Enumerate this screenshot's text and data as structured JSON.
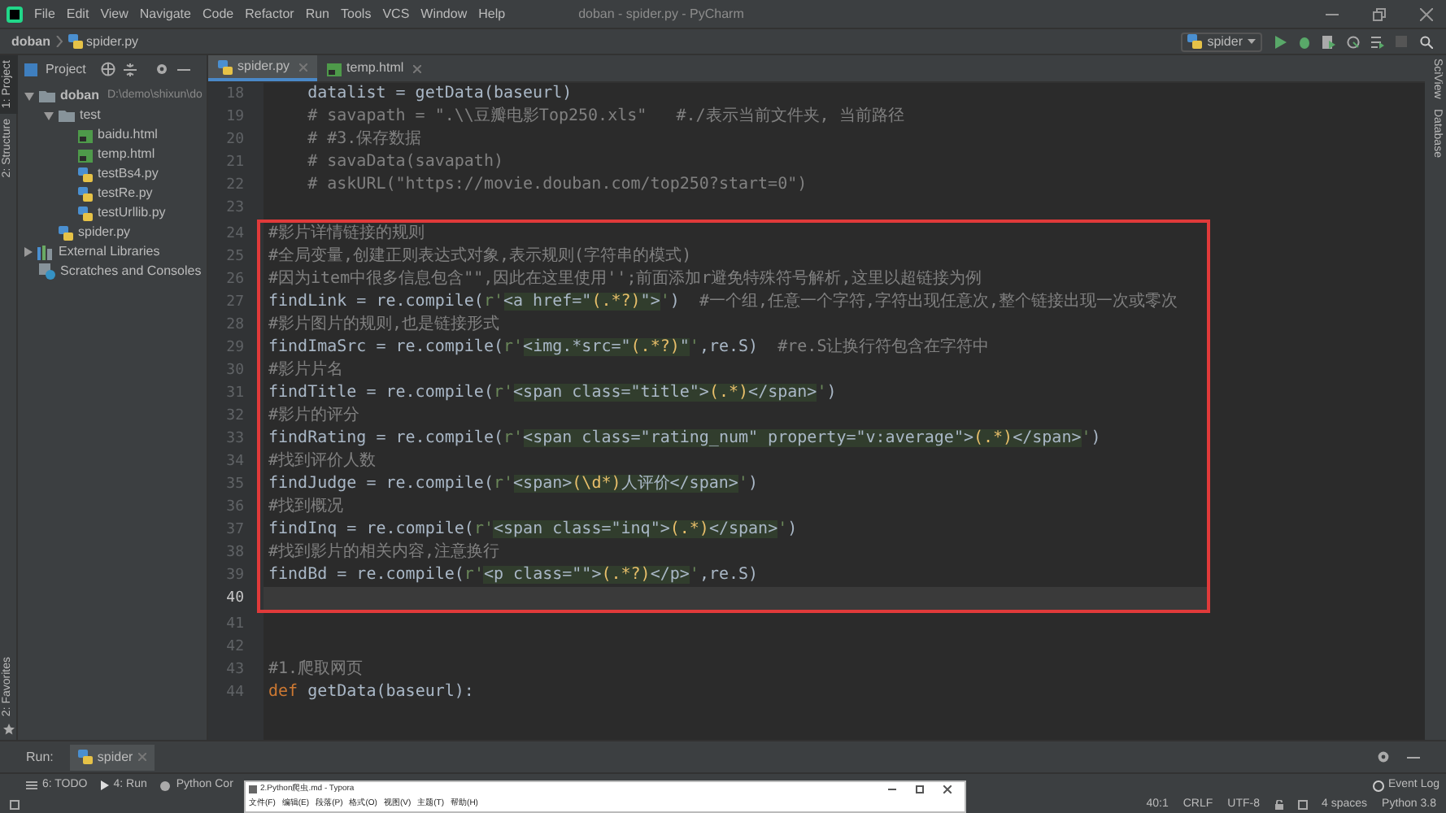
{
  "window": {
    "title": "doban - spider.py - PyCharm"
  },
  "menu": [
    "File",
    "Edit",
    "View",
    "Navigate",
    "Code",
    "Refactor",
    "Run",
    "Tools",
    "VCS",
    "Window",
    "Help"
  ],
  "breadcrumb": [
    "doban",
    "spider.py"
  ],
  "run_config": "spider",
  "left_strip": [
    {
      "label": "1: Project",
      "selected": true
    },
    {
      "label": "2: Structure",
      "selected": false
    }
  ],
  "favorites": "2: Favorites",
  "right_strip": [
    "SciView",
    "Database"
  ],
  "project_panel": {
    "title": "Project",
    "tree": [
      {
        "label": "doban",
        "path": "D:\\demo\\shixun\\do",
        "kind": "folder",
        "expanded": true,
        "children": [
          {
            "label": "test",
            "kind": "folder",
            "expanded": true,
            "children": [
              {
                "label": "baidu.html",
                "kind": "html"
              },
              {
                "label": "temp.html",
                "kind": "html"
              },
              {
                "label": "testBs4.py",
                "kind": "python"
              },
              {
                "label": "testRe.py",
                "kind": "python"
              },
              {
                "label": "testUrllib.py",
                "kind": "python"
              }
            ]
          },
          {
            "label": "spider.py",
            "kind": "python"
          }
        ]
      },
      {
        "label": "External Libraries",
        "kind": "library",
        "expanded": false
      },
      {
        "label": "Scratches and Consoles",
        "kind": "scratch"
      }
    ]
  },
  "tabs": [
    {
      "label": "spider.py",
      "kind": "python",
      "selected": true
    },
    {
      "label": "temp.html",
      "kind": "html",
      "selected": false
    }
  ],
  "editor": {
    "sections": [
      {
        "kind": "plain",
        "lines": [
          {
            "number": "18",
            "current": false,
            "segments": [
              {
                "kind": "code",
                "text": "    datalist = getData(baseurl)"
              }
            ]
          },
          {
            "number": "19",
            "current": false,
            "segments": [
              {
                "kind": "comment",
                "text": "    # savapath = \".\\\\豆瓣电影Top250.xls\"   #./表示当前文件夹, 当前路径"
              }
            ]
          },
          {
            "number": "20",
            "current": false,
            "segments": [
              {
                "kind": "comment",
                "text": "    # #3.保存数据"
              }
            ]
          },
          {
            "number": "21",
            "current": false,
            "segments": [
              {
                "kind": "comment",
                "text": "    # savaData(savapath)"
              }
            ]
          },
          {
            "number": "22",
            "current": false,
            "segments": [
              {
                "kind": "comment",
                "text": "    # askURL(\"https://movie.douban.com/top250?start=0\")"
              }
            ]
          },
          {
            "number": "23",
            "current": false
          }
        ]
      },
      {
        "kind": "boxed",
        "lines": [
          {
            "number": "24",
            "current": false,
            "segments": [
              {
                "kind": "comment",
                "text": "#影片详情链接的规则"
              }
            ]
          },
          {
            "number": "25",
            "current": false,
            "segments": [
              {
                "kind": "comment",
                "text": "#全局变量,创建正则表达式对象,表示规则(字符串的模式)"
              }
            ]
          },
          {
            "number": "26",
            "current": false,
            "segments": [
              {
                "kind": "comment",
                "text": "#因为item中很多信息包含\"\",因此在这里使用'';前面添加r避免特殊符号解析,这里以超链接为例"
              }
            ]
          },
          {
            "number": "27",
            "current": false,
            "segments": [
              {
                "kind": "code",
                "text": "findLink = re.compile("
              },
              {
                "kind": "quote",
                "text": "r'"
              },
              {
                "kind": "regex",
                "text": "<a href=\""
              },
              {
                "kind": "group",
                "text": "(.*?)"
              },
              {
                "kind": "regex",
                "text": "\">"
              },
              {
                "kind": "quote",
                "text": "'"
              },
              {
                "kind": "code",
                "text": ")  "
              },
              {
                "kind": "comment",
                "text": "#一个组,任意一个字符,字符出现任意次,整个链接出现一次或零次"
              }
            ]
          },
          {
            "number": "28",
            "current": false,
            "segments": [
              {
                "kind": "comment",
                "text": "#影片图片的规则,也是链接形式"
              }
            ]
          },
          {
            "number": "29",
            "current": false,
            "segments": [
              {
                "kind": "code",
                "text": "findImaSrc = re.compile("
              },
              {
                "kind": "quote",
                "text": "r'"
              },
              {
                "kind": "regex",
                "text": "<img.*src=\""
              },
              {
                "kind": "group",
                "text": "(.*?)"
              },
              {
                "kind": "regex",
                "text": "\""
              },
              {
                "kind": "quote",
                "text": "'"
              },
              {
                "kind": "code",
                "text": ",re.S)  "
              },
              {
                "kind": "comment",
                "text": "#re.S让换行符包含在字符中"
              }
            ]
          },
          {
            "number": "30",
            "current": false,
            "segments": [
              {
                "kind": "comment",
                "text": "#影片片名"
              }
            ]
          },
          {
            "number": "31",
            "current": false,
            "segments": [
              {
                "kind": "code",
                "text": "findTitle = re.compile("
              },
              {
                "kind": "quote",
                "text": "r'"
              },
              {
                "kind": "regex",
                "text": "<span class=\"title\">"
              },
              {
                "kind": "group",
                "text": "(.*)"
              },
              {
                "kind": "regex",
                "text": "</span>"
              },
              {
                "kind": "quote",
                "text": "'"
              },
              {
                "kind": "code",
                "text": ")"
              }
            ]
          },
          {
            "number": "32",
            "current": false,
            "segments": [
              {
                "kind": "comment",
                "text": "#影片的评分"
              }
            ]
          },
          {
            "number": "33",
            "current": false,
            "segments": [
              {
                "kind": "code",
                "text": "findRating = re.compile("
              },
              {
                "kind": "quote",
                "text": "r'"
              },
              {
                "kind": "regex",
                "text": "<span class=\"rating_num\" property=\"v:average\">"
              },
              {
                "kind": "group",
                "text": "(.*)"
              },
              {
                "kind": "regex",
                "text": "</span>"
              },
              {
                "kind": "quote",
                "text": "'"
              },
              {
                "kind": "code",
                "text": ")"
              }
            ]
          },
          {
            "number": "34",
            "current": false,
            "segments": [
              {
                "kind": "comment",
                "text": "#找到评价人数"
              }
            ]
          },
          {
            "number": "35",
            "current": false,
            "segments": [
              {
                "kind": "code",
                "text": "findJudge = re.compile("
              },
              {
                "kind": "quote",
                "text": "r'"
              },
              {
                "kind": "regex",
                "text": "<span>"
              },
              {
                "kind": "group",
                "text": "(\\d*)"
              },
              {
                "kind": "regex",
                "text": "人评价</span>"
              },
              {
                "kind": "quote",
                "text": "'"
              },
              {
                "kind": "code",
                "text": ")"
              }
            ]
          },
          {
            "number": "36",
            "current": false,
            "segments": [
              {
                "kind": "comment",
                "text": "#找到概况"
              }
            ]
          },
          {
            "number": "37",
            "current": false,
            "segments": [
              {
                "kind": "code",
                "text": "findInq = re.compile("
              },
              {
                "kind": "quote",
                "text": "r'"
              },
              {
                "kind": "regex",
                "text": "<span class=\"inq\">"
              },
              {
                "kind": "group",
                "text": "(.*)"
              },
              {
                "kind": "regex",
                "text": "</span>"
              },
              {
                "kind": "quote",
                "text": "'"
              },
              {
                "kind": "code",
                "text": ")"
              }
            ]
          },
          {
            "number": "38",
            "current": false,
            "segments": [
              {
                "kind": "comment",
                "text": "#找到影片的相关内容,注意换行"
              }
            ]
          },
          {
            "number": "39",
            "current": false,
            "segments": [
              {
                "kind": "code",
                "text": "findBd = re.compile("
              },
              {
                "kind": "quote",
                "text": "r'"
              },
              {
                "kind": "regex",
                "text": "<p class=\"\">"
              },
              {
                "kind": "group",
                "text": "(.*?)"
              },
              {
                "kind": "regex",
                "text": "</p>"
              },
              {
                "kind": "quote",
                "text": "'"
              },
              {
                "kind": "code",
                "text": ",re.S)"
              }
            ]
          },
          {
            "number": "40",
            "current": true
          }
        ]
      },
      {
        "kind": "plain",
        "lines": [
          {
            "number": "41",
            "current": false
          },
          {
            "number": "42",
            "current": false
          },
          {
            "number": "43",
            "current": false,
            "segments": [
              {
                "kind": "comment",
                "text": "#1.爬取网页"
              }
            ]
          },
          {
            "number": "44",
            "current": false,
            "segments": [
              {
                "kind": "keyword",
                "text": "def "
              },
              {
                "kind": "code",
                "text": "getData(baseurl):"
              }
            ]
          }
        ]
      }
    ]
  },
  "run_bar": {
    "label": "Run:",
    "tab": "spider"
  },
  "bottom_tabs": [
    "6: TODO",
    "4: Run",
    "Python Cor"
  ],
  "event_log": "Event Log",
  "typora": {
    "title": "2.Python爬虫.md - Typora",
    "menu": [
      "文件(F)",
      "编辑(E)",
      "段落(P)",
      "格式(O)",
      "视图(V)",
      "主题(T)",
      "帮助(H)"
    ]
  },
  "status_bar": [
    "40:1",
    "CRLF",
    "UTF-8",
    "4 spaces",
    "Python 3.8"
  ]
}
